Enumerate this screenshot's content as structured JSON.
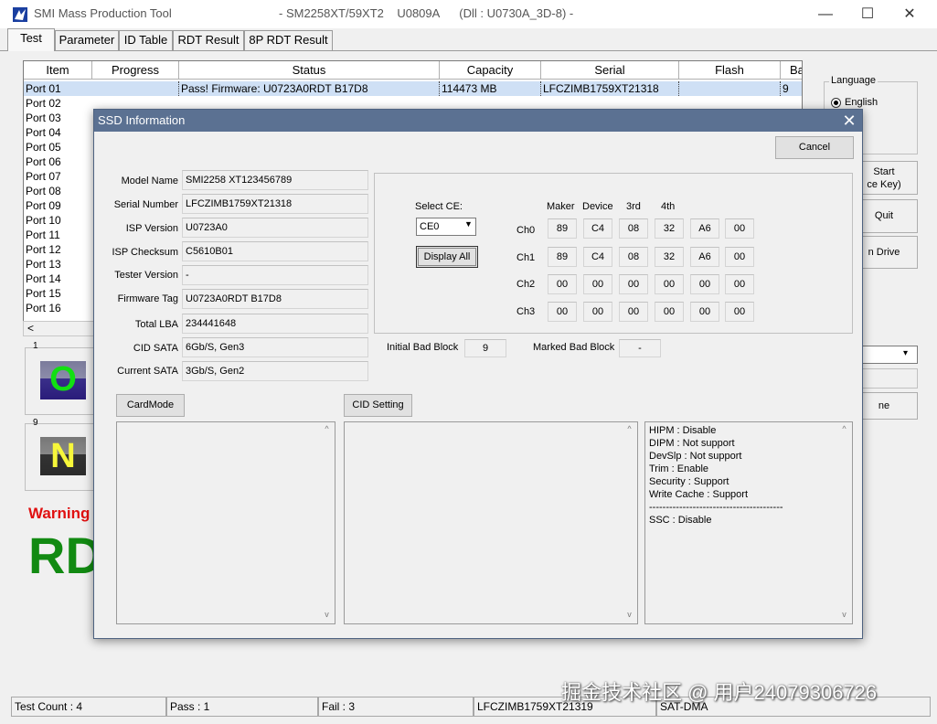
{
  "window": {
    "title": "SMI Mass Production Tool",
    "subtitle": "- SM2258XT/59XT2    U0809A      (Dll : U0730A_3D-8) -",
    "minimize": "—",
    "maximize": "☐",
    "close": "✕"
  },
  "tabs": [
    {
      "label": "Test"
    },
    {
      "label": "Parameter"
    },
    {
      "label": "ID Table"
    },
    {
      "label": "RDT Result"
    },
    {
      "label": "8P RDT Result"
    }
  ],
  "port_list": {
    "columns": [
      "Item",
      "Progress",
      "Status",
      "Capacity",
      "Serial",
      "Flash",
      "Ba"
    ],
    "ports": [
      "Port 01",
      "Port 02",
      "Port 03",
      "Port 04",
      "Port 05",
      "Port 06",
      "Port 07",
      "Port 08",
      "Port 09",
      "Port 10",
      "Port 11",
      "Port 12",
      "Port 13",
      "Port 14",
      "Port 15",
      "Port 16"
    ],
    "selected_row": {
      "progress": "",
      "status": "Pass!  Firmware: U0723A0RDT B17D8",
      "capacity": "114473 MB",
      "serial": "LFCZIMB1759XT21318",
      "flash": "",
      "ba": "9"
    },
    "scroll_left": "<"
  },
  "right_panel": {
    "language_title": "Language",
    "language_option": "English",
    "start_button": "Start\nce Key)",
    "quit_button": "Quit",
    "drive_button": "n Drive",
    "ne_button": "ne",
    "combo_arrow": "▾"
  },
  "port_panels": {
    "panel1_number": "1",
    "panel1_letter": "O",
    "panel9_number": "9",
    "panel9_letter": "N",
    "warning": "Warning",
    "big_text": "RD"
  },
  "status_bar": {
    "test_count": "Test Count : 4",
    "pass": "Pass : 1",
    "fail": "Fail : 3",
    "serial": "LFCZIMB1759XT21319",
    "mode": "SAT-DMA"
  },
  "watermark": "掘金技术社区 @ 用户24079306726",
  "dialog": {
    "title": "SSD Information",
    "close": "✕",
    "cancel": "Cancel",
    "fields": [
      {
        "label": "Model Name",
        "value": "SMI2258 XT123456789"
      },
      {
        "label": "Serial Number",
        "value": "LFCZIMB1759XT21318"
      },
      {
        "label": "ISP Version",
        "value": "U0723A0"
      },
      {
        "label": "ISP Checksum",
        "value": "C5610B01"
      },
      {
        "label": "Tester Version",
        "value": "-"
      },
      {
        "label": "Firmware Tag",
        "value": "U0723A0RDT B17D8"
      },
      {
        "label": "Total LBA",
        "value": "234441648"
      },
      {
        "label": "CID SATA",
        "value": "6Gb/S, Gen3"
      },
      {
        "label": "Current SATA",
        "value": "3Gb/S, Gen2"
      }
    ],
    "select_ce_label": "Select CE:",
    "select_ce_value": "CE0",
    "select_arrow": "▼",
    "display_all": "Display All",
    "id_headers": [
      "Maker",
      "Device",
      "3rd",
      "4th"
    ],
    "channels": [
      {
        "label": "Ch0",
        "bytes": [
          "89",
          "C4",
          "08",
          "32",
          "A6",
          "00"
        ]
      },
      {
        "label": "Ch1",
        "bytes": [
          "89",
          "C4",
          "08",
          "32",
          "A6",
          "00"
        ]
      },
      {
        "label": "Ch2",
        "bytes": [
          "00",
          "00",
          "00",
          "00",
          "00",
          "00"
        ]
      },
      {
        "label": "Ch3",
        "bytes": [
          "00",
          "00",
          "00",
          "00",
          "00",
          "00"
        ]
      }
    ],
    "initial_bad_block_label": "Initial Bad Block",
    "initial_bad_block_value": "9",
    "marked_bad_block_label": "Marked Bad Block",
    "marked_bad_block_value": "-",
    "cardmode_button": "CardMode",
    "cid_setting_button": "CID Setting",
    "info_lines": [
      "HIPM : Disable",
      "DIPM : Not support",
      "DevSlp : Not support",
      "Trim : Enable",
      "Security : Support",
      "Write Cache : Support",
      "----------------------------------------",
      "SSC : Disable"
    ],
    "scroll_up": "^",
    "scroll_down": "v"
  }
}
